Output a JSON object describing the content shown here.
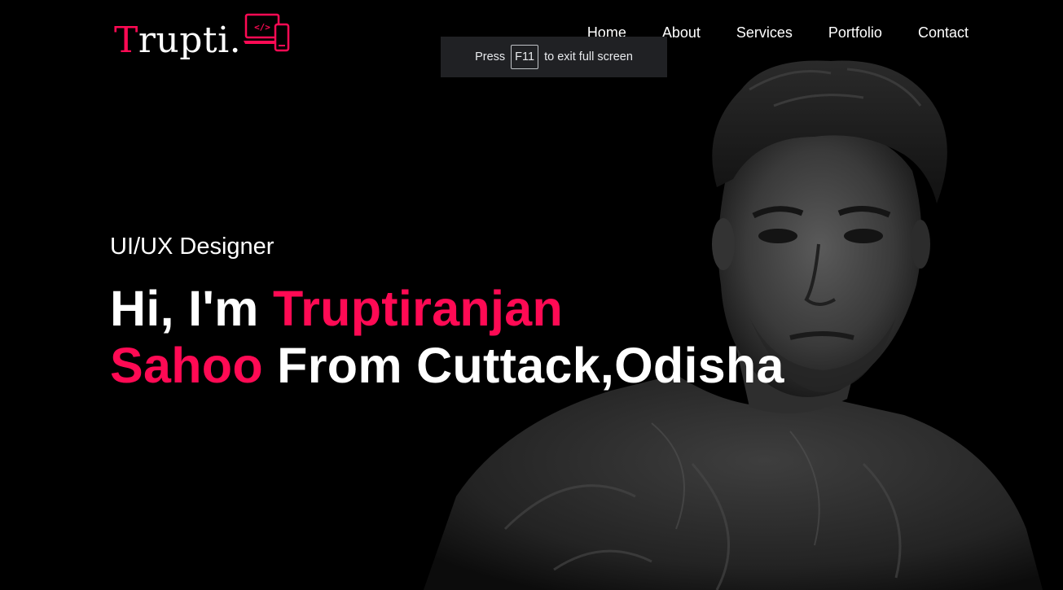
{
  "logo": {
    "first_letter": "T",
    "rest": "rupti.",
    "icon": "laptop-phone-code-icon",
    "accent_color": "#ff0a54"
  },
  "nav": {
    "items": [
      {
        "label": "Home"
      },
      {
        "label": "About"
      },
      {
        "label": "Services"
      },
      {
        "label": "Portfolio"
      },
      {
        "label": "Contact"
      }
    ]
  },
  "fullscreen_toast": {
    "prefix": "Press",
    "key": "F11",
    "suffix": "to exit full screen"
  },
  "hero": {
    "role": "UI/UX Designer",
    "greeting": "Hi, I'm",
    "name_first": "Truptiranjan",
    "name_last": "Sahoo",
    "location": "From Cuttack,Odisha"
  },
  "colors": {
    "background": "#000000",
    "accent": "#ff0a54",
    "text": "#ffffff"
  }
}
